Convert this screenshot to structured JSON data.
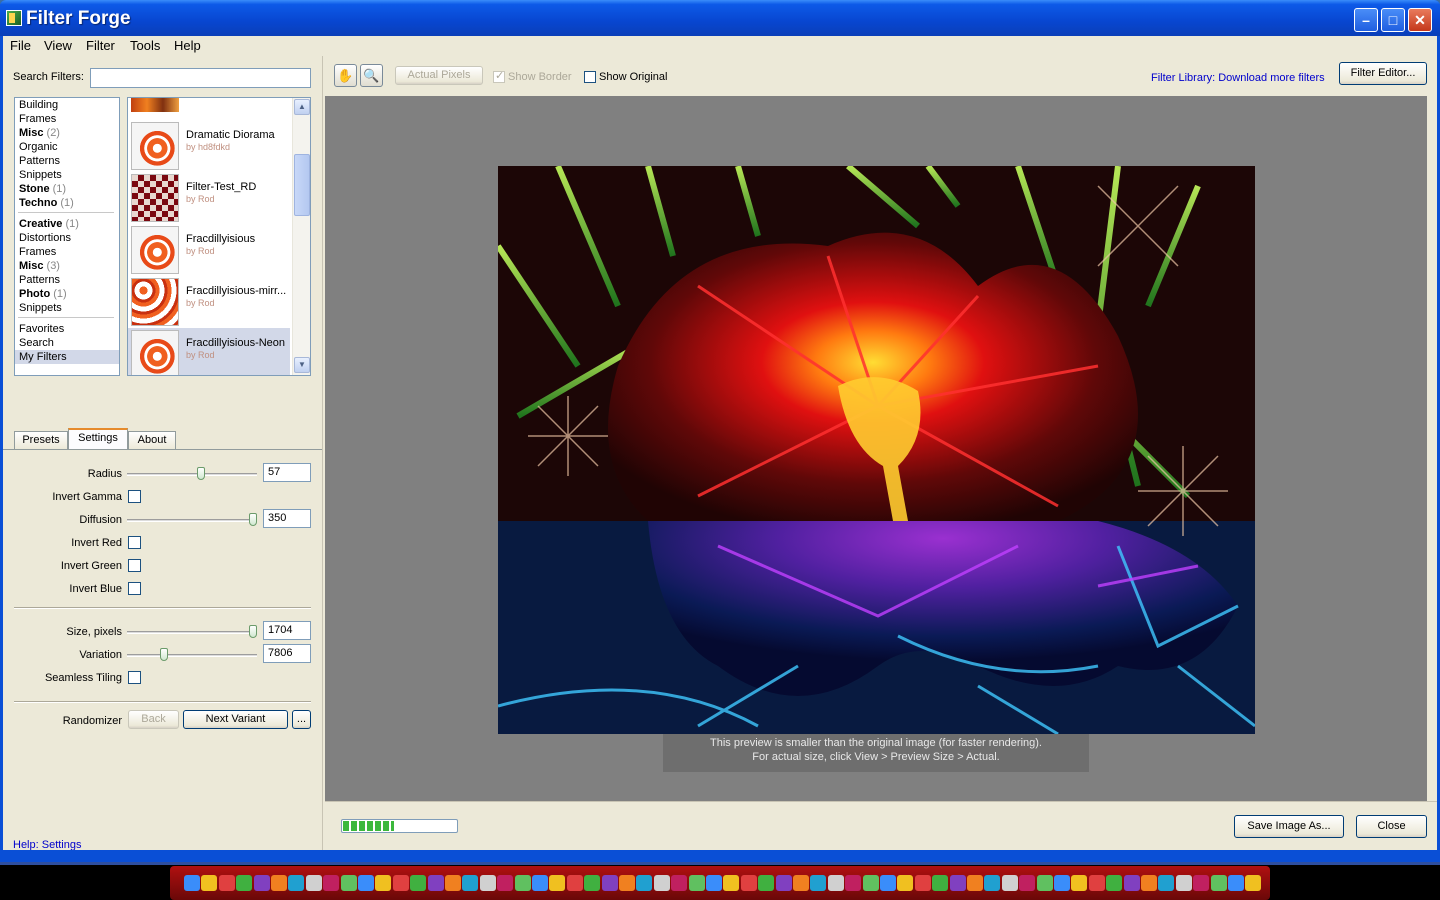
{
  "window": {
    "title": "Filter Forge"
  },
  "menu": [
    "File",
    "View",
    "Filter",
    "Tools",
    "Help"
  ],
  "search": {
    "label": "Search Filters:",
    "value": ""
  },
  "categories": [
    {
      "label": "Building",
      "bold": false,
      "count": ""
    },
    {
      "label": "Frames",
      "bold": false,
      "count": ""
    },
    {
      "label": "Misc",
      "bold": true,
      "count": "(2)"
    },
    {
      "label": "Organic",
      "bold": false,
      "count": ""
    },
    {
      "label": "Patterns",
      "bold": false,
      "count": ""
    },
    {
      "label": "Snippets",
      "bold": false,
      "count": ""
    },
    {
      "label": "Stone",
      "bold": true,
      "count": "(1)"
    },
    {
      "label": "Techno",
      "bold": true,
      "count": "(1)"
    },
    {
      "sep": true
    },
    {
      "label": "Creative",
      "bold": true,
      "count": "(1)"
    },
    {
      "label": "Distortions",
      "bold": false,
      "count": ""
    },
    {
      "label": "Frames",
      "bold": false,
      "count": ""
    },
    {
      "label": "Misc",
      "bold": true,
      "count": "(3)"
    },
    {
      "label": "Patterns",
      "bold": false,
      "count": ""
    },
    {
      "label": "Photo",
      "bold": true,
      "count": "(1)"
    },
    {
      "label": "Snippets",
      "bold": false,
      "count": ""
    },
    {
      "sep": true
    },
    {
      "label": "Favorites",
      "bold": false,
      "count": ""
    },
    {
      "label": "Search",
      "bold": false,
      "count": ""
    },
    {
      "label": "My Filters",
      "bold": false,
      "count": "",
      "selected": true
    }
  ],
  "filters": [
    {
      "name": "Dramatic Diorama",
      "author": "by hd8fdkd",
      "thumb": "orange"
    },
    {
      "name": "Filter-Test_RD",
      "author": "by Rod",
      "thumb": "red"
    },
    {
      "name": "Fracdillyisious",
      "author": "by Rod",
      "thumb": "orange"
    },
    {
      "name": "Fracdillyisious-mirr...",
      "author": "by Rod",
      "thumb": "kaleido"
    },
    {
      "name": "Fracdillyisious-Neon",
      "author": "by Rod",
      "thumb": "orange",
      "selected": true
    }
  ],
  "tabs": [
    "Presets",
    "Settings",
    "About"
  ],
  "active_tab": "Settings",
  "settings": {
    "radius": {
      "label": "Radius",
      "value": "57",
      "level": 0.57
    },
    "invert_gamma": {
      "label": "Invert Gamma",
      "checked": false
    },
    "diffusion": {
      "label": "Diffusion",
      "value": "350",
      "level": 1.0
    },
    "invert_red": {
      "label": "Invert Red",
      "checked": false
    },
    "invert_green": {
      "label": "Invert Green",
      "checked": false
    },
    "invert_blue": {
      "label": "Invert Blue",
      "checked": false
    },
    "size": {
      "label": "Size, pixels",
      "value": "1704",
      "level": 1.0
    },
    "variation": {
      "label": "Variation",
      "value": "7806",
      "level": 0.27
    },
    "seamless": {
      "label": "Seamless Tiling",
      "checked": false
    }
  },
  "randomizer": {
    "label": "Randomizer",
    "back": "Back",
    "next": "Next Variant",
    "more": "..."
  },
  "help": {
    "label": "Help: Settings"
  },
  "toolbar": {
    "actual_pixels": "Actual Pixels",
    "show_border": "Show Border",
    "show_original": "Show Original",
    "library_link": "Filter Library: Download more filters",
    "editor": "Filter Editor..."
  },
  "preview": {
    "notice_line1": "This preview is smaller than the original image (for faster rendering).",
    "notice_line2": "For actual size, click View > Preview Size > Actual.",
    "progress": 0.45
  },
  "footer": {
    "save": "Save Image As...",
    "close": "Close"
  },
  "colors": {
    "title_bar": "#0846d0",
    "accent": "#e68b2c",
    "link": "#0000cc"
  }
}
